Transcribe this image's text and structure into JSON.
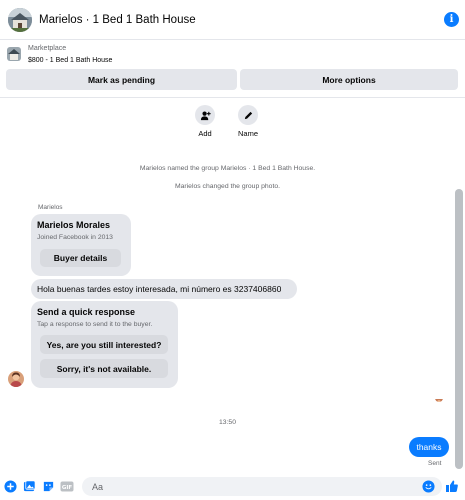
{
  "header": {
    "title": "Marielos · 1 Bed 1 Bath House"
  },
  "marketplace": {
    "source": "Marketplace",
    "item": "$800 - 1 Bed 1 Bath House",
    "mark_pending_label": "Mark as pending",
    "more_options_label": "More options"
  },
  "actions": {
    "add_label": "Add",
    "name_label": "Name"
  },
  "system_messages": [
    "Marielos named the group Marielos · 1 Bed 1 Bath House.",
    "Marielos changed the group photo."
  ],
  "profile_card": {
    "sender": "Marielos",
    "name": "Marielos Morales",
    "joined": "Joined Facebook in 2013",
    "button": "Buyer details"
  },
  "incoming_message": "Hola buenas tardes estoy interesada, mi número es 3237406860",
  "quick_response": {
    "title": "Send a quick response",
    "subtitle": "Tap a response to send it to the buyer.",
    "options": [
      "Yes, are you still interested?",
      "Sorry, it's not available."
    ]
  },
  "timestamp": "13:50",
  "outgoing_message": "thanks",
  "sent_status": "Sent",
  "composer": {
    "placeholder": "Aa",
    "value": ""
  },
  "colors": {
    "accent": "#0a7cff",
    "bubble": "#e4e6eb",
    "muted_text": "#65676b"
  }
}
